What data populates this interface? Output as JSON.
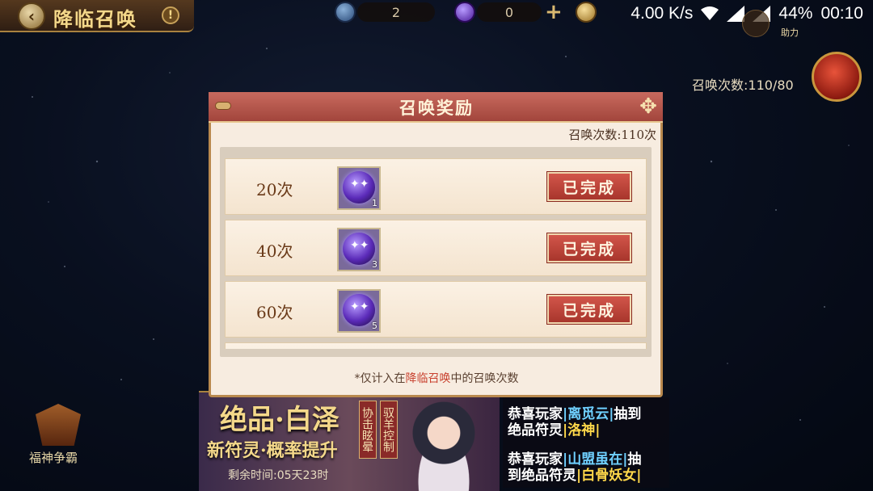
{
  "status_bar": {
    "speed": "4.00 K/s",
    "battery": "44%",
    "time": "00:10"
  },
  "header": {
    "title": "降临召唤",
    "info": "!"
  },
  "currencies": [
    {
      "value": "2"
    },
    {
      "value": "0"
    }
  ],
  "plus": "+",
  "right_panel": {
    "help_label": "助力",
    "summon_count": "召唤次数:110/80"
  },
  "left_panel": {
    "label": "福神争霸"
  },
  "banner": {
    "title": "绝品·白泽",
    "subtitle": "新符灵·概率提升",
    "time": "剩余时间:05天23时",
    "tag1": "协击眩晕",
    "tag2": "驭羊控制"
  },
  "announcements": [
    {
      "pre": "恭喜玩家",
      "player": "|离觅云|",
      "mid": "抽到",
      "line2": "绝品符灵",
      "item": "|洛神|"
    },
    {
      "pre": "恭喜玩家",
      "player": "|山盟虽在|",
      "mid": "抽",
      "line2": "到绝品符灵",
      "item": "|白骨妖女|"
    }
  ],
  "dialog": {
    "title": "召唤奖励",
    "count_label": "召唤次数:110次",
    "rows": [
      {
        "times": "20次",
        "qty": "1",
        "status": "已完成"
      },
      {
        "times": "40次",
        "qty": "3",
        "status": "已完成"
      },
      {
        "times": "60次",
        "qty": "5",
        "status": "已完成"
      }
    ],
    "footnote_pre": "*仅计入在",
    "footnote_hl": "降临召唤",
    "footnote_post": "中的召唤次数"
  },
  "colors": {
    "dialog_header": "#b85448",
    "done_button": "#c04a3e",
    "accent_gold": "#f4d88a"
  }
}
